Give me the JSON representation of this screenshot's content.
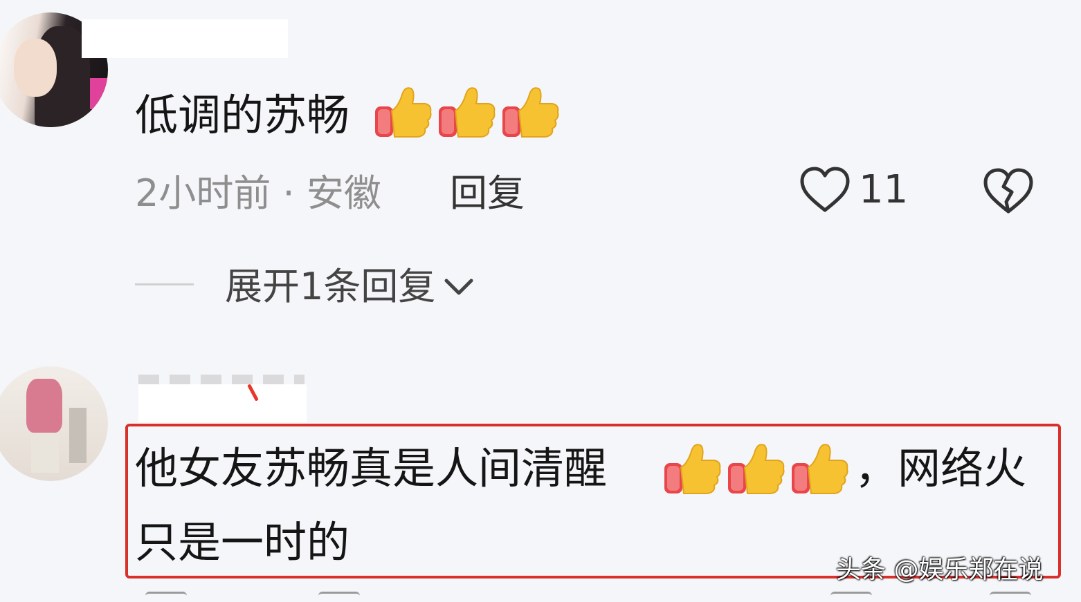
{
  "comments": [
    {
      "text": "低调的苏畅",
      "emoji_count": 3,
      "emoji_icon": "thumbs-up-icon",
      "time": "2小时前",
      "separator": "·",
      "location": "安徽",
      "reply_label": "回复",
      "likes": "11",
      "expand_label": "展开1条回复"
    },
    {
      "text_part1": "他女友苏畅真是人间清醒",
      "emoji_count": 3,
      "emoji_icon": "thumbs-up-icon",
      "text_part2": "，网络火",
      "text_line2": "只是一时的"
    }
  ],
  "watermark": "头条 @娱乐郑在说",
  "colors": {
    "background": "#f5f6f9",
    "highlight_border": "#d9302c",
    "meta_text": "#8e8e8e"
  }
}
